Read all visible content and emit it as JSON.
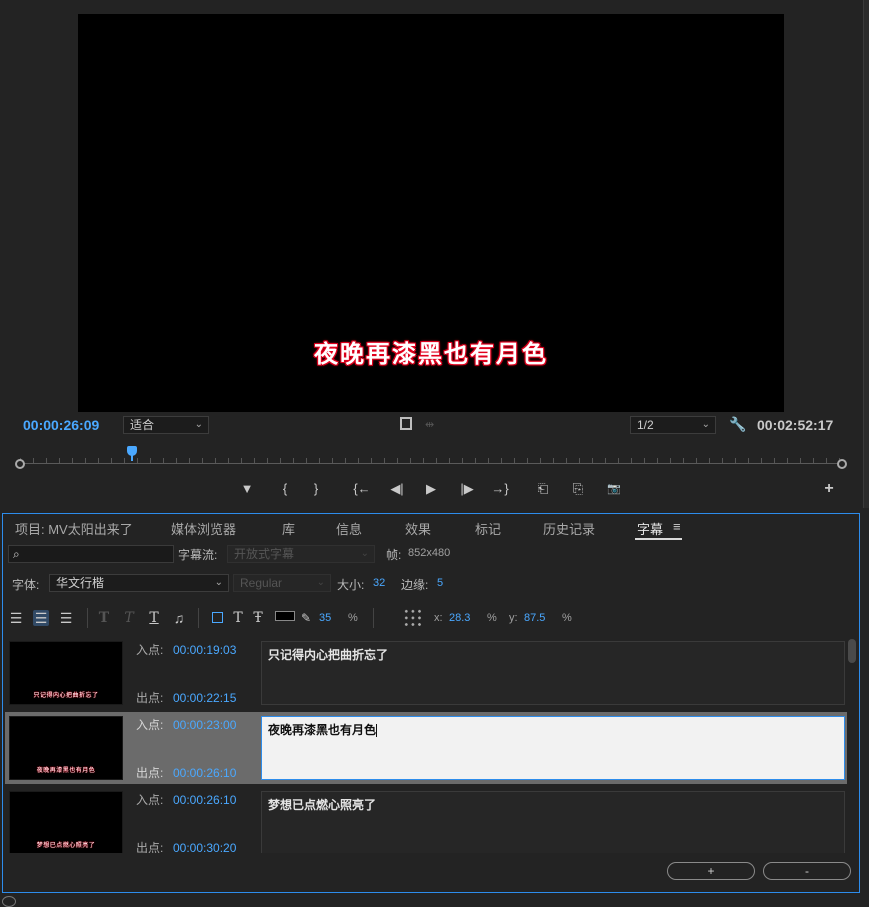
{
  "monitor": {
    "overlay_caption": "夜晚再漆黑也有月色",
    "current_timecode": "00:00:26:09",
    "fit_select": "适合",
    "resolution_select": "1/2",
    "duration_timecode": "00:02:52:17",
    "transport": {
      "marker": "▼",
      "mark_in": "{",
      "mark_out": "}",
      "go_to_in": "{←",
      "step_back": "◀|",
      "play": "▶",
      "step_forward": "|▶",
      "go_to_out": "→}",
      "insert": "⎗",
      "overwrite": "⎘",
      "export_frame": "📷",
      "add": "+"
    }
  },
  "panel": {
    "tabs": [
      {
        "label": "项目: MV太阳出来了"
      },
      {
        "label": "媒体浏览器"
      },
      {
        "label": "库"
      },
      {
        "label": "信息"
      },
      {
        "label": "效果"
      },
      {
        "label": "标记"
      },
      {
        "label": "历史记录"
      },
      {
        "label": "字幕"
      }
    ],
    "menu_icon": "≡",
    "search_icon": "⌕",
    "stream_label": "字幕流:",
    "stream_value": "开放式字幕",
    "frame_label": "帧:",
    "frame_value": "852x480",
    "font_label": "字体:",
    "font_value": "华文行楷",
    "style_value": "Regular",
    "size_label": "大小:",
    "size_value": "32",
    "edge_label": "边缘:",
    "edge_value": "5",
    "opacity_value": "35",
    "percent": "%",
    "x_label": "x:",
    "x_value": "28.3",
    "y_label": "y:",
    "y_value": "87.5",
    "captions": [
      {
        "in_label": "入点:",
        "in": "00:00:19:03",
        "out_label": "出点:",
        "out": "00:00:22:15",
        "text": "只记得内心把曲折忘了",
        "selected": false
      },
      {
        "in_label": "入点:",
        "in": "00:00:23:00",
        "out_label": "出点:",
        "out": "00:00:26:10",
        "text": "夜晚再漆黑也有月色",
        "selected": true
      },
      {
        "in_label": "入点:",
        "in": "00:00:26:10",
        "out_label": "出点:",
        "out": "00:00:30:20",
        "text": "梦想已点燃心照亮了",
        "selected": false
      }
    ],
    "add_button": "+",
    "remove_button": "-"
  },
  "colors": {
    "accent_blue": "#4aa8ff",
    "panel_border": "#2d8ceb",
    "caption_glow": "#e1001e"
  }
}
